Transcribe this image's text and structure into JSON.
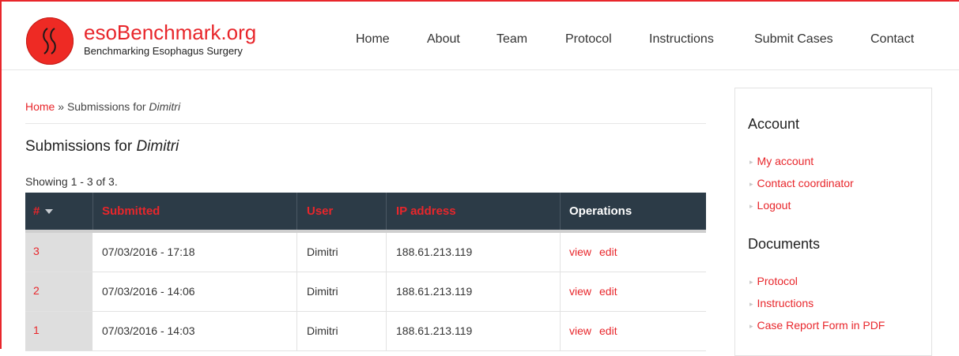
{
  "site": {
    "name": "esoBenchmark.org",
    "slogan": "Benchmarking Esophagus Surgery"
  },
  "nav": [
    "Home",
    "About",
    "Team",
    "Protocol",
    "Instructions",
    "Submit Cases",
    "Contact"
  ],
  "breadcrumb": {
    "home": "Home",
    "sep": " » ",
    "current_prefix": "Submissions for ",
    "current_user": "Dimitri"
  },
  "page": {
    "title_prefix": "Submissions for ",
    "title_user": "Dimitri",
    "showing": "Showing 1 - 3 of 3."
  },
  "table": {
    "headers": {
      "id": "#",
      "submitted": "Submitted",
      "user": "User",
      "ip": "IP address",
      "operations": "Operations"
    },
    "sort_icon": "caret-down-icon",
    "rows": [
      {
        "id": "3",
        "submitted": "07/03/2016 - 17:18",
        "user": "Dimitri",
        "ip": "188.61.213.119",
        "view": "view",
        "edit": "edit"
      },
      {
        "id": "2",
        "submitted": "07/03/2016 - 14:06",
        "user": "Dimitri",
        "ip": "188.61.213.119",
        "view": "view",
        "edit": "edit"
      },
      {
        "id": "1",
        "submitted": "07/03/2016 - 14:03",
        "user": "Dimitri",
        "ip": "188.61.213.119",
        "view": "view",
        "edit": "edit"
      }
    ]
  },
  "sidebar": {
    "account_title": "Account",
    "account_links": [
      "My account",
      "Contact coordinator",
      "Logout"
    ],
    "documents_title": "Documents",
    "document_links": [
      "Protocol",
      "Instructions",
      "Case Report Form in PDF"
    ]
  },
  "colors": {
    "accent": "#e8262b",
    "table_header": "#2c3b47",
    "id_column": "#dedede"
  }
}
